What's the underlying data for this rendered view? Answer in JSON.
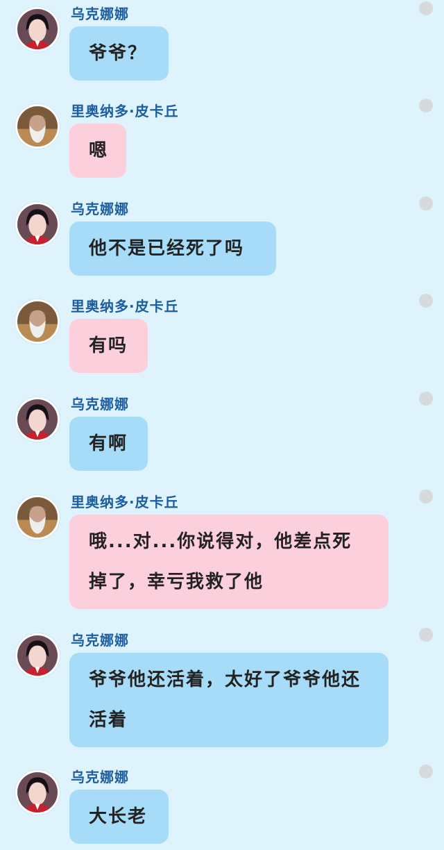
{
  "messages": [
    {
      "speaker": "乌克娜娜",
      "text": "爷爷？",
      "color": "blue",
      "avatar": "girl-avatar"
    },
    {
      "speaker": "里奥纳多·皮卡丘",
      "text": "嗯",
      "color": "pink",
      "avatar": "elder-avatar"
    },
    {
      "speaker": "乌克娜娜",
      "text": "他不是已经死了吗",
      "color": "blue",
      "avatar": "girl-avatar"
    },
    {
      "speaker": "里奥纳多·皮卡丘",
      "text": "有吗",
      "color": "pink",
      "avatar": "elder-avatar"
    },
    {
      "speaker": "乌克娜娜",
      "text": "有啊",
      "color": "blue",
      "avatar": "girl-avatar"
    },
    {
      "speaker": "里奥纳多·皮卡丘",
      "text": "哦...对...你说得对，他差点死掉了，幸亏我救了他",
      "color": "pink",
      "avatar": "elder-avatar"
    },
    {
      "speaker": "乌克娜娜",
      "text": "爷爷他还活着，太好了爷爷他还活着",
      "color": "blue",
      "avatar": "girl-avatar"
    },
    {
      "speaker": "乌克娜娜",
      "text": "大长老",
      "color": "blue",
      "avatar": "girl-avatar"
    }
  ],
  "colors": {
    "background": "#dff3fc",
    "bubble_blue": "#a6dcf7",
    "bubble_pink": "#fbd0dc",
    "name": "#1d5ea0"
  }
}
